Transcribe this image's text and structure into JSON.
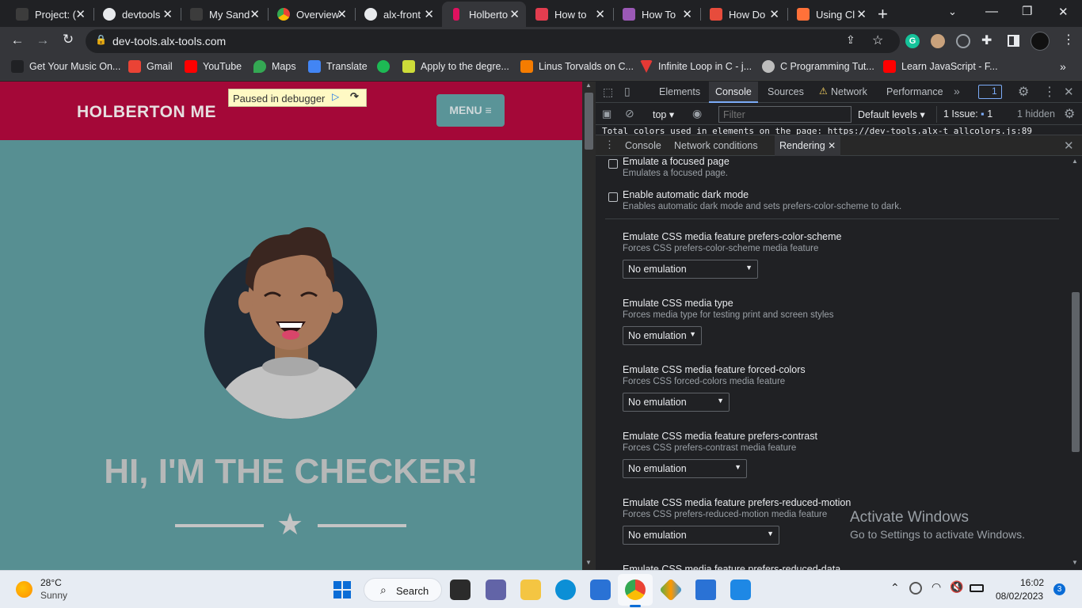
{
  "browser": {
    "tabs": [
      {
        "label": "Project: (",
        "icon_color": "#3c3c3c",
        "active": false
      },
      {
        "label": "devtools",
        "icon_color": "#e8eaed",
        "active": false
      },
      {
        "label": "My Sand",
        "icon_color": "#3c3c3c",
        "active": false
      },
      {
        "label": "Overview",
        "icon_color": "#4285f4",
        "active": false
      },
      {
        "label": "alx-front",
        "icon_color": "#e8eaed",
        "active": false
      },
      {
        "label": "Holberto",
        "icon_color": "#e0115f",
        "active": true
      },
      {
        "label": "How to",
        "icon_color": "#e23d4f",
        "active": false
      },
      {
        "label": "How To",
        "icon_color": "#9b59b6",
        "active": false
      },
      {
        "label": "How Do",
        "icon_color": "#e74c3c",
        "active": false
      },
      {
        "label": "Using Cl",
        "icon_color": "#ff7139",
        "active": false
      }
    ],
    "url": "dev-tools.alx-tools.com",
    "bookmarks": [
      {
        "label": "Get Your Music On...",
        "icon_color": "#202124"
      },
      {
        "label": "Gmail",
        "icon_color": "#ea4335"
      },
      {
        "label": "YouTube",
        "icon_color": "#ff0000"
      },
      {
        "label": "Maps",
        "icon_color": "#34a853"
      },
      {
        "label": "Translate",
        "icon_color": "#4285f4"
      },
      {
        "label": "",
        "icon_color": "#1db954"
      },
      {
        "label": "Apply to the degre...",
        "icon_color": "#cddc39"
      },
      {
        "label": "Linus Torvalds on C...",
        "icon_color": "#f57c00"
      },
      {
        "label": "Infinite Loop in C - j...",
        "icon_color": "#e53935"
      },
      {
        "label": "C Programming Tut...",
        "icon_color": "#bdbdbd"
      },
      {
        "label": "Learn JavaScript - F...",
        "icon_color": "#ff0000"
      }
    ]
  },
  "page": {
    "brand": "HOLBERTON ME",
    "menu_label": "MENU ≡",
    "debugger_label": "Paused in debugger",
    "hero_title": "HI, I'M THE CHECKER!",
    "colors": {
      "header": "#a40838",
      "background": "#578f92"
    }
  },
  "devtools": {
    "tabs": [
      "Elements",
      "Console",
      "Sources",
      "Network",
      "Performance"
    ],
    "active_tab": "Console",
    "badge_count": "1",
    "console_bar": {
      "context": "top",
      "filter_placeholder": "Filter",
      "levels": "Default levels",
      "issues": "1 Issue:",
      "issues_count": "1",
      "hidden": "1 hidden"
    },
    "console_line": "Total colors used in elements on the page: https://dev-tools.alx-t allcolors.js:89",
    "drawer_tabs": [
      "Console",
      "Network conditions",
      "Rendering"
    ],
    "checkboxes": [
      {
        "title": "Emulate a focused page",
        "desc": "Emulates a focused page.",
        "checked": false
      },
      {
        "title": "Enable automatic dark mode",
        "desc": "Enables automatic dark mode and sets prefers-color-scheme to dark.",
        "checked": false
      }
    ],
    "options": [
      {
        "title": "Emulate CSS media feature prefers-color-scheme",
        "desc": "Forces CSS prefers-color-scheme media feature",
        "value": "No emulation"
      },
      {
        "title": "Emulate CSS media type",
        "desc": "Forces media type for testing print and screen styles",
        "value": "No emulation"
      },
      {
        "title": "Emulate CSS media feature forced-colors",
        "desc": "Forces CSS forced-colors media feature",
        "value": "No emulation"
      },
      {
        "title": "Emulate CSS media feature prefers-contrast",
        "desc": "Forces CSS prefers-contrast media feature",
        "value": "No emulation"
      },
      {
        "title": "Emulate CSS media feature prefers-reduced-motion",
        "desc": "Forces CSS prefers-reduced-motion media feature",
        "value": "No emulation"
      },
      {
        "title": "Emulate CSS media feature prefers-reduced-data",
        "desc": "",
        "value": ""
      }
    ],
    "watermark_title": "Activate Windows",
    "watermark_sub": "Go to Settings to activate Windows."
  },
  "taskbar": {
    "weather_temp": "28°C",
    "weather_desc": "Sunny",
    "search_label": "Search",
    "time": "16:02",
    "date": "08/02/2023",
    "notif_count": "3"
  }
}
